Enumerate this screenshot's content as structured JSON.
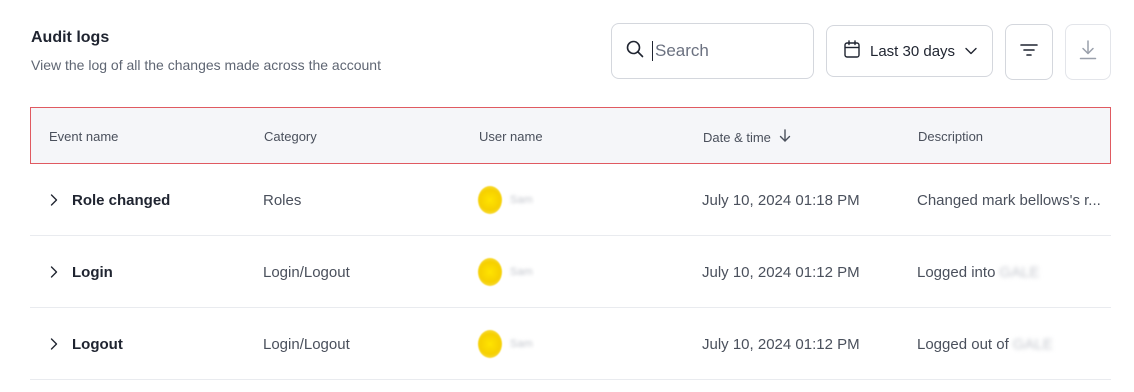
{
  "header": {
    "title": "Audit logs",
    "subtitle": "View the log of all the changes made across the account"
  },
  "toolbar": {
    "search_placeholder": "Search",
    "search_value": "",
    "date_range": "Last 30 days",
    "icons": {
      "search": "search-icon",
      "calendar": "calendar-icon",
      "chevron": "chevron-down-icon",
      "filter": "filter-icon",
      "download": "download-icon"
    }
  },
  "table": {
    "columns": [
      "Event name",
      "Category",
      "User name",
      "Date & time",
      "Description"
    ],
    "sorted_column": "Date & time",
    "sort_direction": "descending",
    "rows": [
      {
        "event": "Role changed",
        "category": "Roles",
        "user": "Sam",
        "datetime": "July 10, 2024 01:18 PM",
        "description": "Changed mark bellows's r...",
        "description_redacted": ""
      },
      {
        "event": "Login",
        "category": "Login/Logout",
        "user": "Sam",
        "datetime": "July 10, 2024 01:12 PM",
        "description": "Logged into",
        "description_redacted": "GALE"
      },
      {
        "event": "Logout",
        "category": "Login/Logout",
        "user": "Sam",
        "datetime": "July 10, 2024 01:12 PM",
        "description": "Logged out of",
        "description_redacted": "GALE"
      }
    ]
  },
  "colors": {
    "highlight_border": "#e05a61",
    "header_bg": "#f5f6f9",
    "avatar": "#f6d000"
  }
}
